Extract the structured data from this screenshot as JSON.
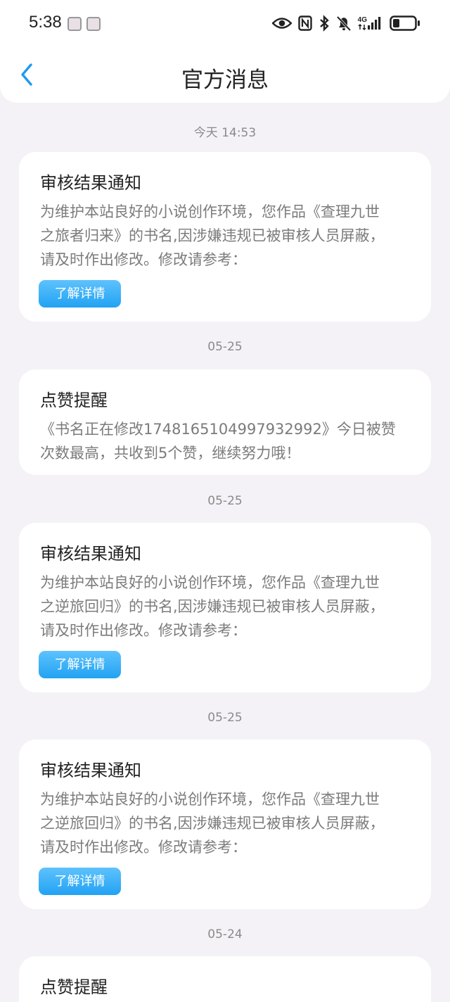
{
  "status_bar": {
    "time": "5:38",
    "network": "4G"
  },
  "header": {
    "title": "官方消息"
  },
  "messages": [
    {
      "timestamp": "今天 14:53",
      "title": "审核结果通知",
      "body_lines": [
        "为维护本站良好的小说创作环境，您作品《查理九世",
        "之旅者归来》的书名,因涉嫌违规已被审核人员屏蔽，",
        "请及时作出修改。修改请参考："
      ],
      "button": "了解详情"
    },
    {
      "timestamp": "05-25",
      "title": "点赞提醒",
      "body_lines": [
        "《书名正在修改17481651049979329​92》今日被赞",
        "次数最高，共收到5个赞，继续努力哦！"
      ]
    },
    {
      "timestamp": "05-25",
      "title": "审核结果通知",
      "body_lines": [
        "为维护本站良好的小说创作环境，您作品《查理九世",
        "之逆旅回归》的书名,因涉嫌违规已被审核人员屏蔽，",
        "请及时作出修改。修改请参考："
      ],
      "button": "了解详情"
    },
    {
      "timestamp": "05-25",
      "title": "审核结果通知",
      "body_lines": [
        "为维护本站良好的小说创作环境，您作品《查理九世",
        "之逆旅回归》的书名,因涉嫌违规已被审核人员屏蔽，",
        "请及时作出修改。修改请参考："
      ],
      "button": "了解详情"
    },
    {
      "timestamp": "05-24",
      "title": "点赞提醒"
    }
  ]
}
